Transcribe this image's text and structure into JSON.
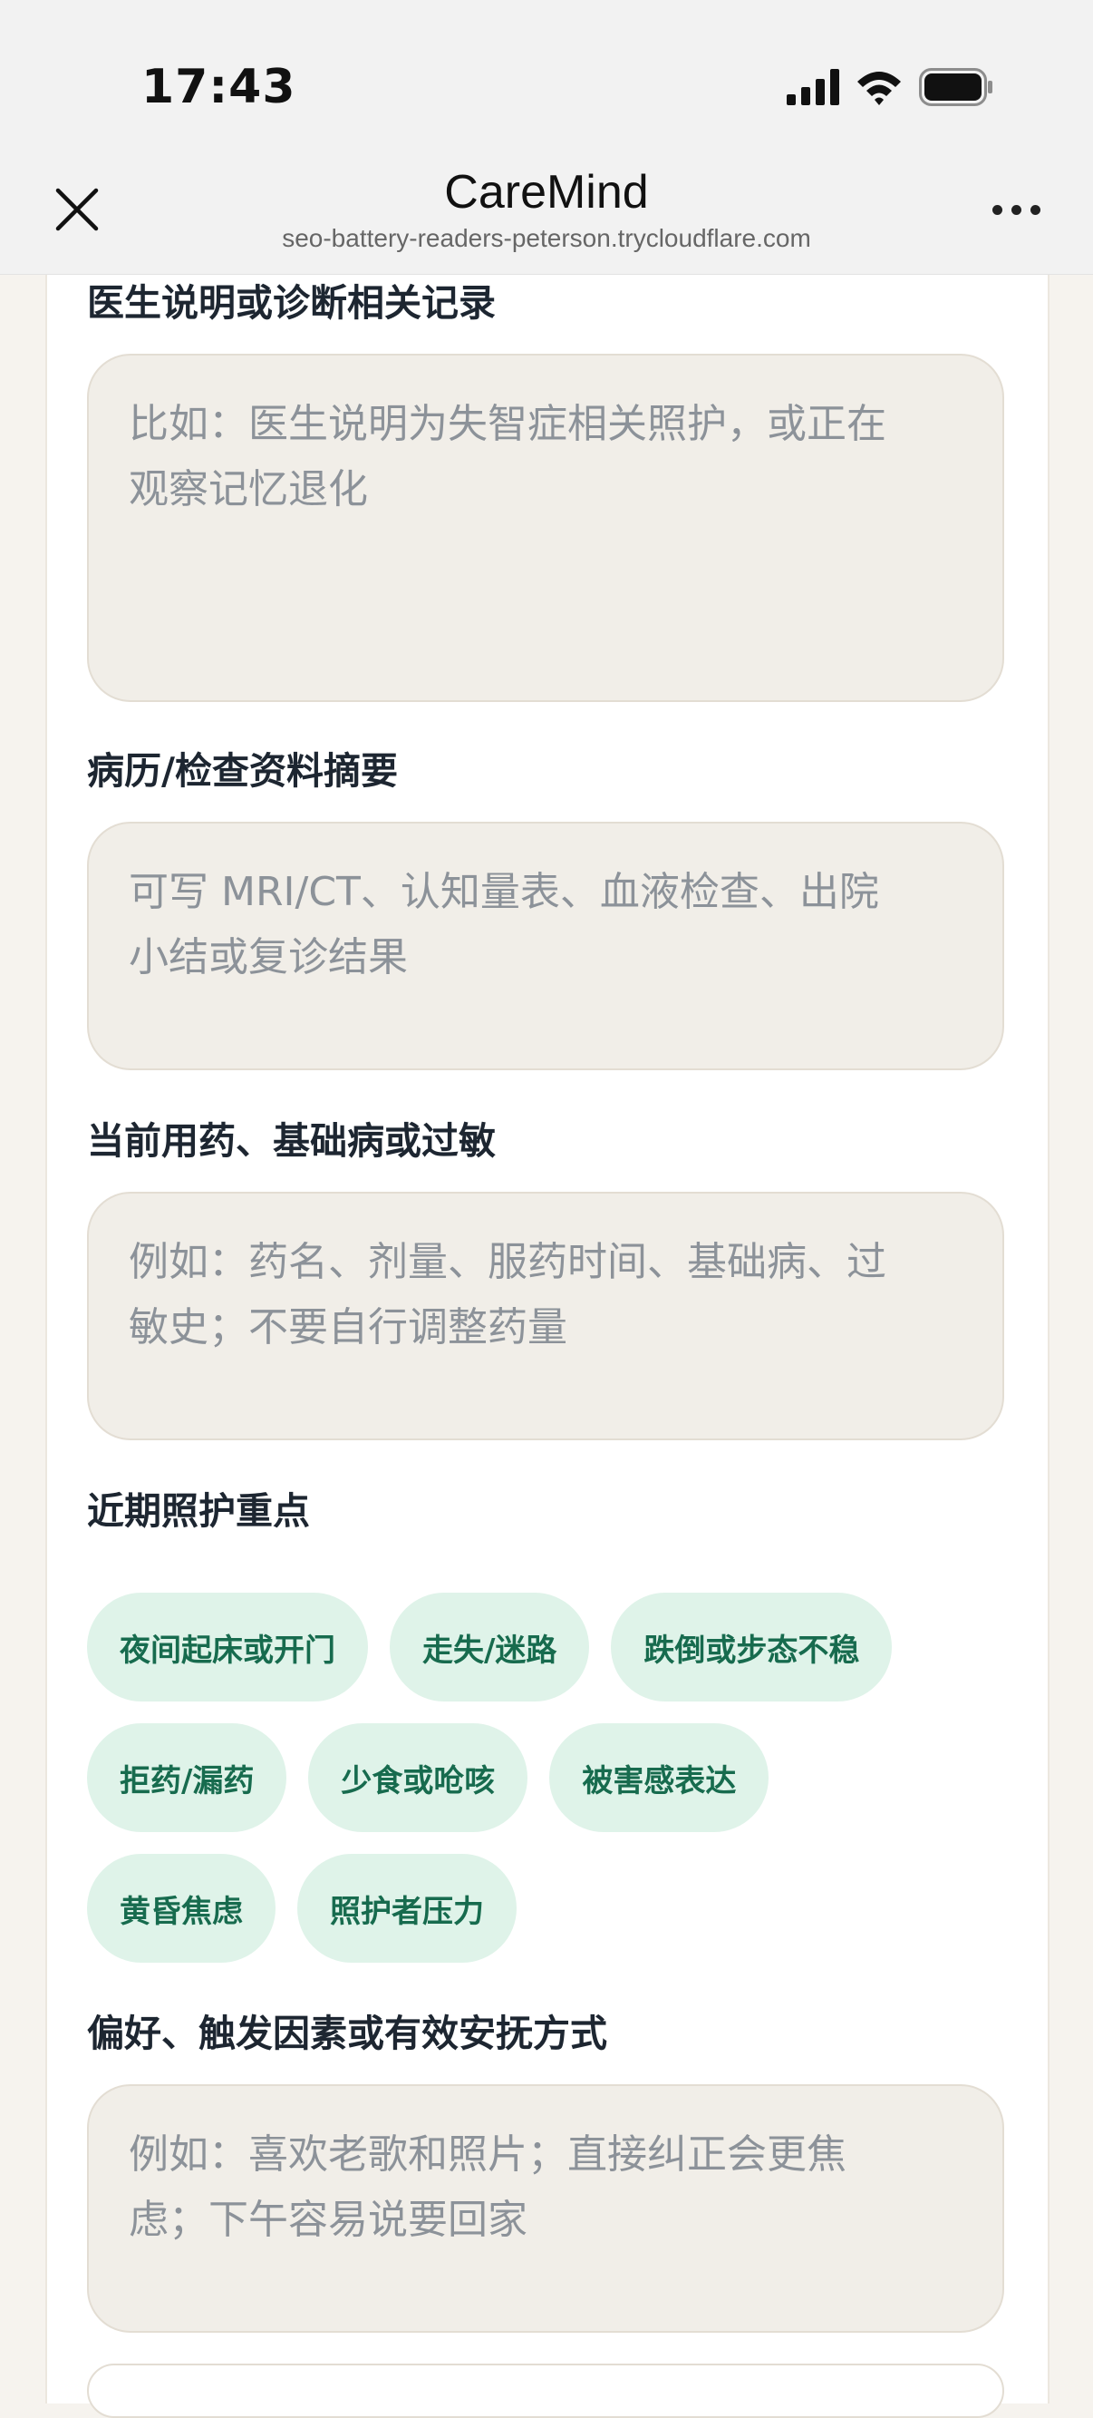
{
  "status_bar": {
    "time": "17:43"
  },
  "browser": {
    "title": "CareMind",
    "url": "seo-battery-readers-peterson.trycloudflare.com"
  },
  "form": {
    "doctor_notes": {
      "label": "医生说明或诊断相关记录",
      "placeholder_line1": "比如：医生说明为失智症相关照护，或正在",
      "placeholder_line2": "观察记忆退化"
    },
    "medical_records": {
      "label": "病历/检查资料摘要",
      "placeholder_line1": "可写 MRI/CT、认知量表、血液检查、出院",
      "placeholder_line2": "小结或复诊结果"
    },
    "medications": {
      "label": "当前用药、基础病或过敏",
      "placeholder_line1": "例如：药名、剂量、服药时间、基础病、过",
      "placeholder_line2": "敏史；不要自行调整药量"
    },
    "care_focus": {
      "label": "近期照护重点",
      "chips": [
        "夜间起床或开门",
        "走失/迷路",
        "跌倒或步态不稳",
        "拒药/漏药",
        "少食或呛咳",
        "被害感表达",
        "黄昏焦虑",
        "照护者压力"
      ]
    },
    "preferences": {
      "label": "偏好、触发因素或有效安抚方式",
      "placeholder_line1": "例如：喜欢老歌和照片；直接纠正会更焦",
      "placeholder_line2": "虑；下午容易说要回家"
    }
  }
}
